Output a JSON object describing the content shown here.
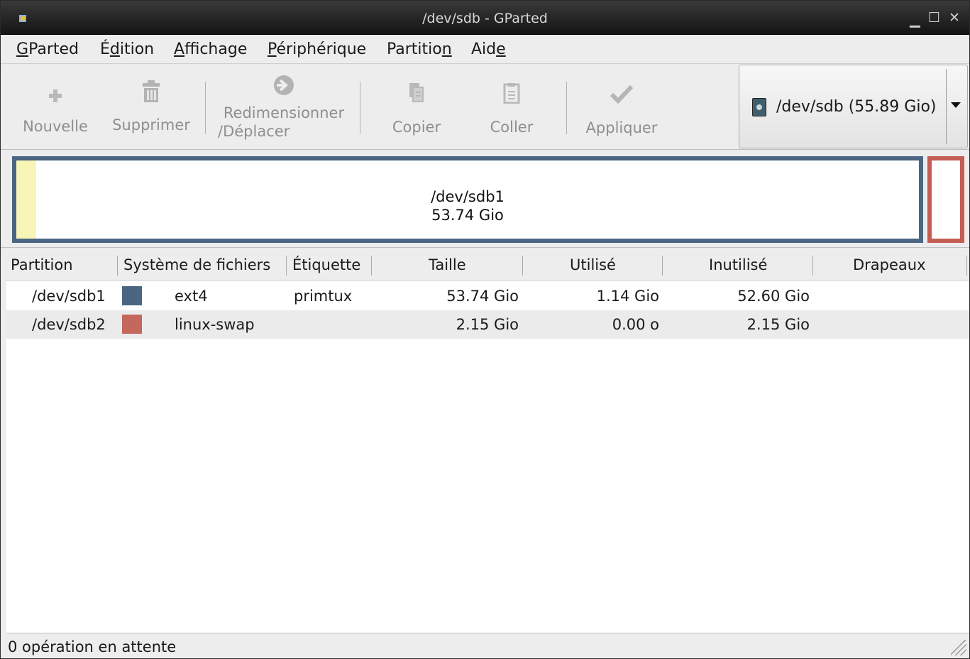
{
  "window": {
    "title": "/dev/sdb - GParted"
  },
  "menu": [
    {
      "label": "GParted",
      "underline_char": "G"
    },
    {
      "label": "Édition",
      "underline_char": "d"
    },
    {
      "label": "Affichage",
      "underline_char": "A"
    },
    {
      "label": "Périphérique",
      "underline_char": "P"
    },
    {
      "label": "Partition",
      "underline_char": "n"
    },
    {
      "label": "Aide",
      "underline_char": "e"
    }
  ],
  "toolbar": {
    "new": "Nouvelle",
    "delete": "Supprimer",
    "resize_line1": "Redimensionner",
    "resize_line2": "/Déplacer",
    "copy": "Copier",
    "paste": "Coller",
    "apply": "Appliquer"
  },
  "device": {
    "label": "/dev/sdb  (55.89 Gio)"
  },
  "disk_map": {
    "partition_name": "/dev/sdb1",
    "partition_size": "53.74 Gio"
  },
  "table": {
    "columns": [
      "Partition",
      "Système de fichiers",
      "Étiquette",
      "Taille",
      "Utilisé",
      "Inutilisé",
      "Drapeaux"
    ],
    "rows": [
      {
        "partition": "/dev/sdb1",
        "fs": "ext4",
        "fs_color": "#4a6683",
        "label": "primtux",
        "size": "53.74 Gio",
        "used": "1.14 Gio",
        "unused": "52.60 Gio",
        "flags": ""
      },
      {
        "partition": "/dev/sdb2",
        "fs": "linux-swap",
        "fs_color": "#c4675d",
        "label": "",
        "size": "2.15 Gio",
        "used": "0.00 o",
        "unused": "2.15 Gio",
        "flags": ""
      }
    ]
  },
  "status": {
    "text": "0 opération en attente"
  }
}
